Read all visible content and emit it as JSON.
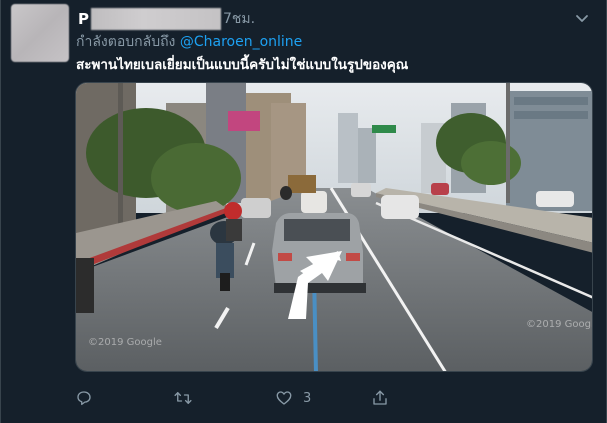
{
  "tweet": {
    "author_initial": "P",
    "time": "7ชม.",
    "reply_prefix": "กำลังตอบกลับถึง",
    "reply_mention": "@Charoen_online",
    "text": "สะพานไทยเบลเยี่ยมเป็นแบบนี้ครับไม่ใช่แบบในรูปของคุณ",
    "watermark": "©2019 Google",
    "actions": {
      "reply_icon": "reply-icon",
      "retweet_icon": "retweet-icon",
      "like_icon": "heart-icon",
      "like_count": "3",
      "share_icon": "share-icon"
    }
  },
  "colors": {
    "background": "#15202b",
    "secondary_text": "#8899a6",
    "link": "#1da1f2",
    "border": "#38444d"
  }
}
